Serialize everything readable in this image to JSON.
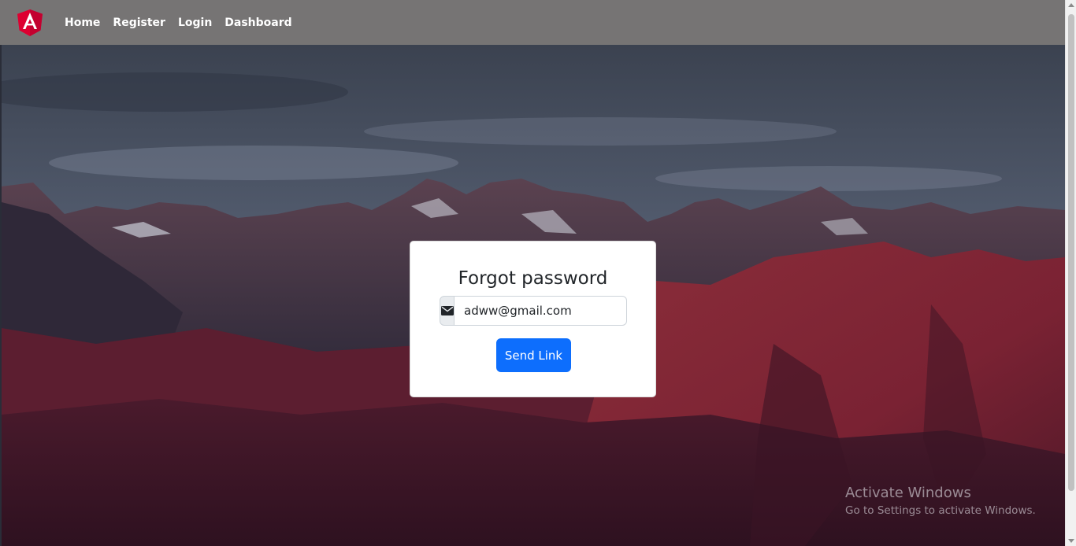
{
  "navbar": {
    "logo_icon": "angular-logo-icon",
    "links": [
      "Home",
      "Register",
      "Login",
      "Dashboard"
    ]
  },
  "card": {
    "title": "Forgot password",
    "email_icon": "envelope-icon",
    "email_value": "adww@gmail.com",
    "button_label": "Send Link"
  },
  "watermark": {
    "title": "Activate Windows",
    "subtitle": "Go to Settings to activate Windows."
  },
  "colors": {
    "navbar": "#767474",
    "primary": "#0d6efd",
    "angular_red": "#dd0031"
  }
}
